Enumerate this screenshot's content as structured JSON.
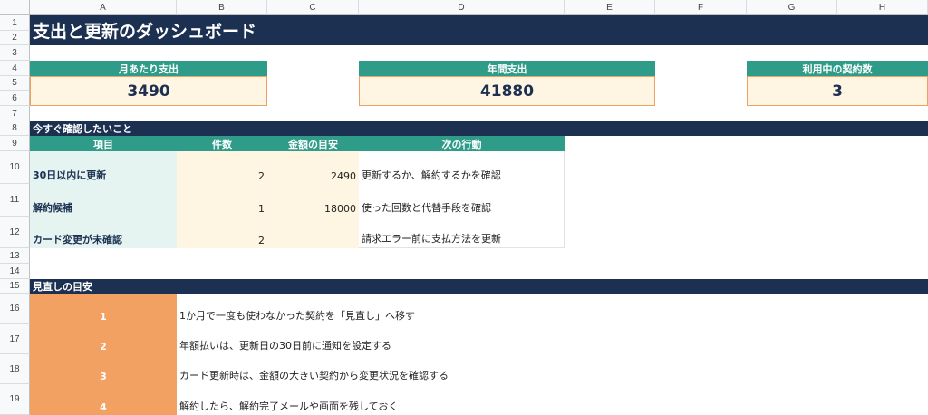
{
  "columns": [
    "A",
    "B",
    "C",
    "D",
    "E",
    "F",
    "G",
    "H"
  ],
  "rows": [
    "1",
    "2",
    "3",
    "4",
    "5",
    "6",
    "7",
    "8",
    "9",
    "10",
    "11",
    "12",
    "13",
    "14",
    "15",
    "16",
    "17",
    "18",
    "19"
  ],
  "title": "支出と更新のダッシュボード",
  "cards": [
    {
      "label": "月あたり支出",
      "value": "3490"
    },
    {
      "label": "年間支出",
      "value": "41880"
    },
    {
      "label": "利用中の契約数",
      "value": "3"
    }
  ],
  "check_section": {
    "heading": "今すぐ確認したいこと",
    "headers": [
      "項目",
      "件数",
      "金額の目安",
      "次の行動"
    ],
    "rows": [
      {
        "item": "30日以内に更新",
        "count": "2",
        "amount": "2490",
        "action": "更新するか、解約するかを確認"
      },
      {
        "item": "解約候補",
        "count": "1",
        "amount": "18000",
        "action": "使った回数と代替手段を確認"
      },
      {
        "item": "カード変更が未確認",
        "count": "2",
        "amount": "",
        "action": "請求エラー前に支払方法を更新"
      }
    ]
  },
  "review_section": {
    "heading": "見直しの目安",
    "items": [
      {
        "no": "1",
        "text": "1か月で一度も使わなかった契約を「見直し」へ移す"
      },
      {
        "no": "2",
        "text": "年額払いは、更新日の30日前に通知を設定する"
      },
      {
        "no": "3",
        "text": "カード更新時は、金額の大きい契約から変更状況を確認する"
      },
      {
        "no": "4",
        "text": "解約したら、解約完了メールや画面を残しておく"
      }
    ]
  },
  "colors": {
    "navy": "#1c3052",
    "teal": "#2e9c88",
    "orange": "#f3a163",
    "cream": "#fff5e3",
    "mint": "#e6f4f1"
  }
}
